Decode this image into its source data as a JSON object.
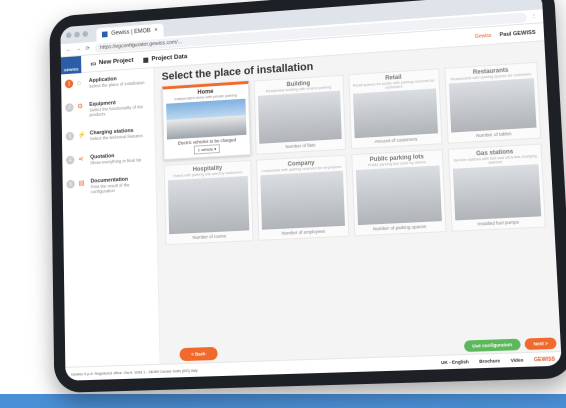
{
  "browser": {
    "tab_title": "Gewiss | EMOB",
    "url": "https://egconfigurator.gewiss.com/..."
  },
  "appbar": {
    "brand": "GEWISS",
    "new_project": "New Project",
    "project_data": "Project Data",
    "language_short": "Gewiss",
    "user": "Paul GEWISS"
  },
  "steps": [
    {
      "n": "1",
      "title": "Application",
      "desc": "Select the place of installation"
    },
    {
      "n": "2",
      "title": "Equipment",
      "desc": "Select the functionality of the products"
    },
    {
      "n": "3",
      "title": "Charging stations",
      "desc": "Select the technical features"
    },
    {
      "n": "4",
      "title": "Quotation",
      "desc": "Show everything in final list"
    },
    {
      "n": "5",
      "title": "Documentation",
      "desc": "Print the result of the configuration"
    }
  ],
  "main": {
    "heading": "Select the place of installation",
    "cards": [
      {
        "title": "Home",
        "sub": "Independent home with private parking",
        "q": "Electric vehicles to be charged",
        "v": "1 vehicle"
      },
      {
        "title": "Building",
        "sub": "Residential building with shared parking",
        "q": "Number of flats",
        "v": ""
      },
      {
        "title": "Retail",
        "sub": "Retail spaces for public with parking reserved for customers",
        "q": "Amount of customers",
        "v": ""
      },
      {
        "title": "Restaurants",
        "sub": "Restaurants with parking spaces for customers",
        "q": "Number of tables",
        "v": ""
      },
      {
        "title": "Hospitality",
        "sub": "Hotels with parking lots used by customers",
        "q": "Number of rooms",
        "v": ""
      },
      {
        "title": "Company",
        "sub": "Companies with parking reserved for employees",
        "q": "Number of employees",
        "v": ""
      },
      {
        "title": "Public parking lots",
        "sub": "Public parking lots used by drivers",
        "q": "Number of parking spaces",
        "v": ""
      },
      {
        "title": "Gas stations",
        "sub": "Service stations with fast and ultra-fast charging stations",
        "q": "Installed fuel pumps",
        "v": ""
      }
    ],
    "back": "< Back",
    "config": "Use configuration",
    "next": "Next >"
  },
  "footer": {
    "legal": "Gewiss S.p.A. Registered office: Via A. Volta 1 - 24069 Cenate Sotto (BG) Italy",
    "lang": "UK - English",
    "brochure": "Brochure",
    "video": "Video",
    "brand": "GEWISS"
  }
}
